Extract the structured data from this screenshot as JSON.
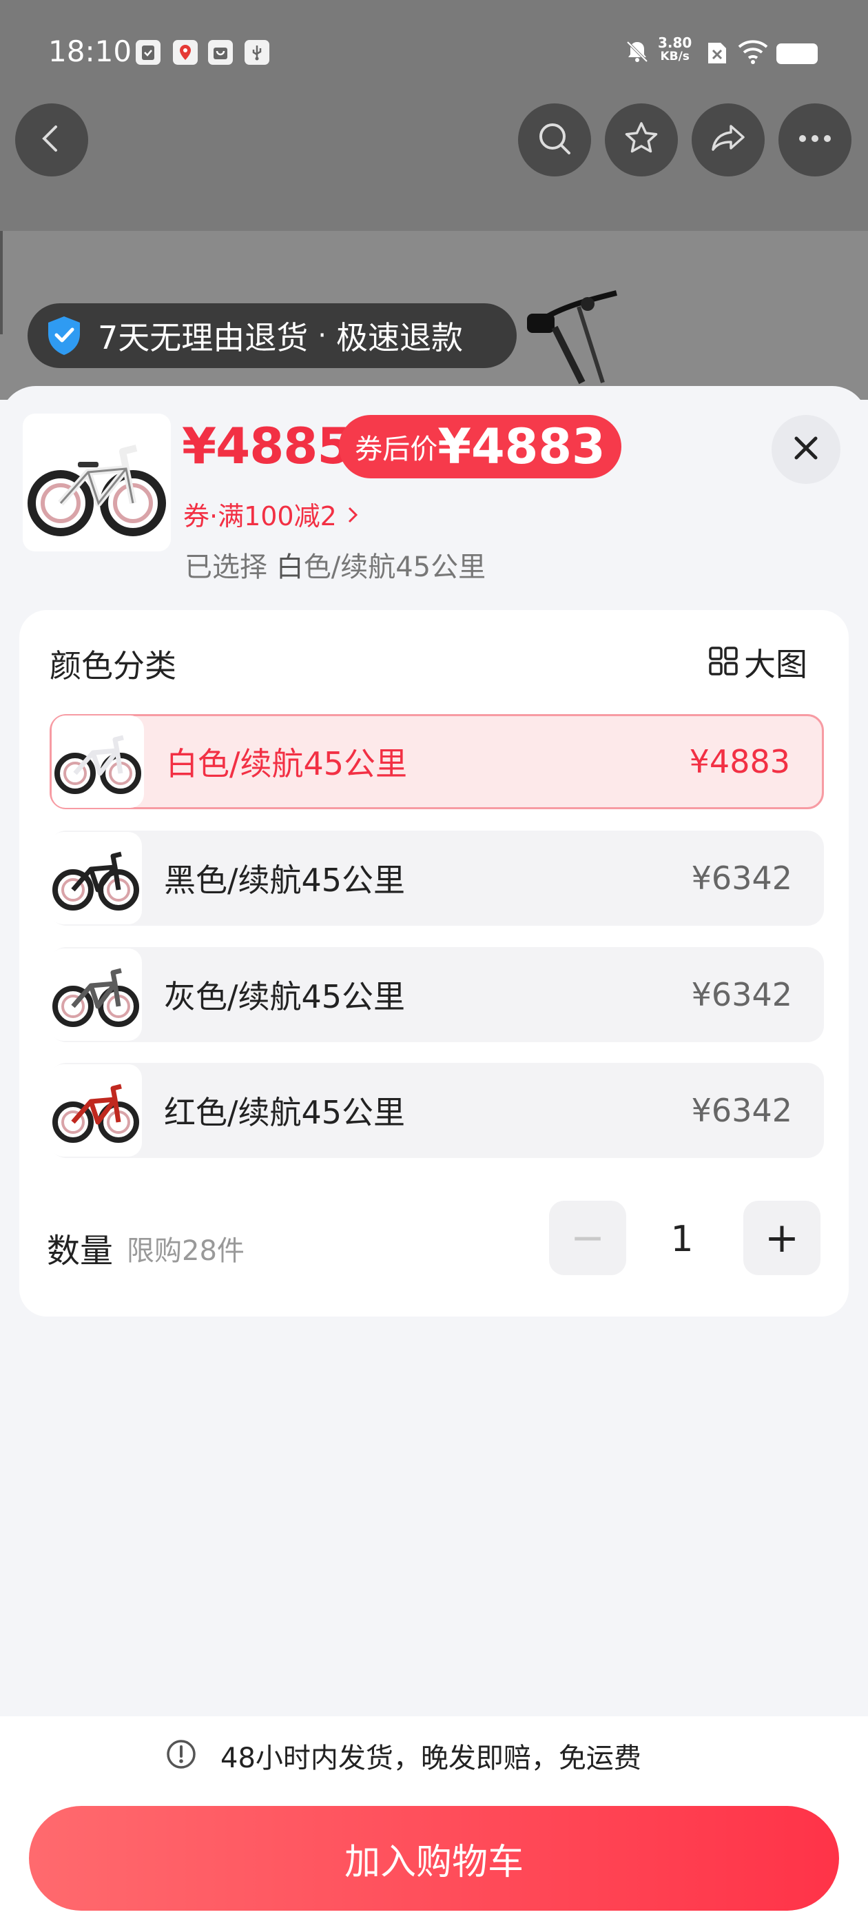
{
  "status_bar": {
    "time": "18:10",
    "net_speed_value": "3.80",
    "net_speed_unit": "KB/s",
    "icons": [
      "clipboard-icon",
      "map-pin-icon",
      "shopping-bag-icon",
      "usb-icon",
      "bell-mute-icon",
      "sim-off-icon",
      "wifi-icon",
      "battery-icon"
    ]
  },
  "nav": {
    "back": "chevron-left-icon",
    "search": "search-icon",
    "favorite": "star-icon",
    "share": "share-icon",
    "more": "more-icon"
  },
  "return_badge": {
    "text1": "7天无理由退货",
    "separator": "·",
    "text2": "极速退款"
  },
  "product": {
    "price": "¥4885",
    "coupon_price_label": "券后价",
    "coupon_price": "¥4883",
    "coupon_text": "券·满100减2",
    "selected_prefix": "已选择",
    "selected_first": "白",
    "selected_rest": "色/续航45公里"
  },
  "options": {
    "title": "颜色分类",
    "big_view_label": "大图",
    "variants": [
      {
        "name": "白色/续航45公里",
        "price": "¥4883",
        "selected": true,
        "frame_color": "#e8e8ec"
      },
      {
        "name": "黑色/续航45公里",
        "price": "¥6342",
        "selected": false,
        "frame_color": "#222222"
      },
      {
        "name": "灰色/续航45公里",
        "price": "¥6342",
        "selected": false,
        "frame_color": "#5c5c5c"
      },
      {
        "name": "红色/续航45公里",
        "price": "¥6342",
        "selected": false,
        "frame_color": "#c0281f"
      }
    ]
  },
  "quantity": {
    "label": "数量",
    "limit": "限购28件",
    "value": "1",
    "minus": "−",
    "plus": "+"
  },
  "bottom": {
    "shipping_note": "48小时内发货，晚发即赔，免运费",
    "add_to_cart": "加入购物车"
  }
}
